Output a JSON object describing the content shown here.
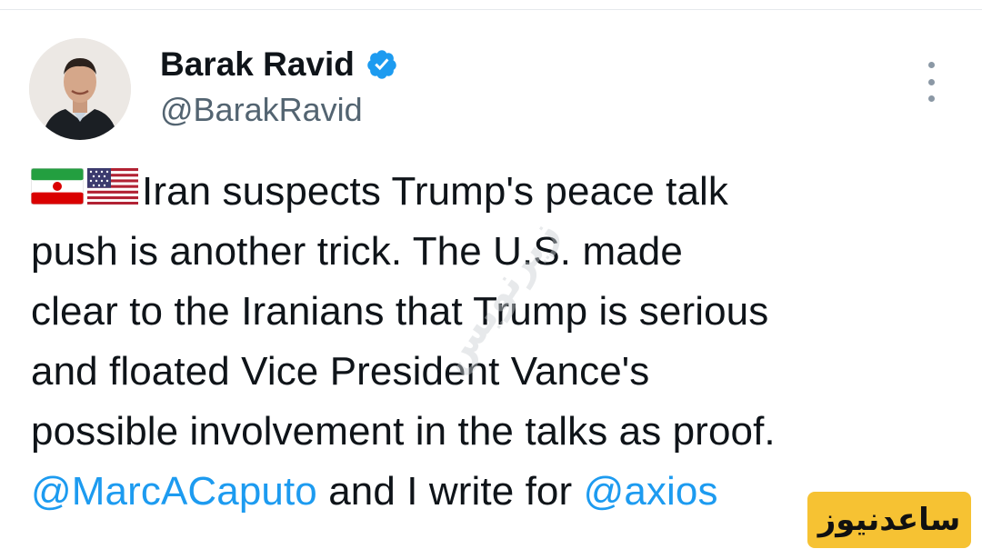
{
  "author": {
    "display_name": "Barak Ravid",
    "handle": "@BarakRavid"
  },
  "tweet": {
    "line1": "Iran suspects Trump's peace talk",
    "line2": "push is another trick. The U.S. made",
    "line3": "clear to the Iranians that Trump is serious",
    "line4": "and floated Vice President Vance's",
    "line5": "possible involvement in the talks as proof.",
    "mention1": "@MarcACaputo",
    "middle": " and I write for ",
    "mention2": "@axios"
  },
  "watermark_text": "زیرنویس",
  "badge_text": "ساعدنیوز",
  "colors": {
    "link": "#1d9bf0",
    "verified": "#1d9bf0",
    "badge": "#f6c233"
  },
  "icons": [
    "verified-badge-icon",
    "more-options-icon",
    "iran-flag-icon",
    "us-flag-icon"
  ]
}
